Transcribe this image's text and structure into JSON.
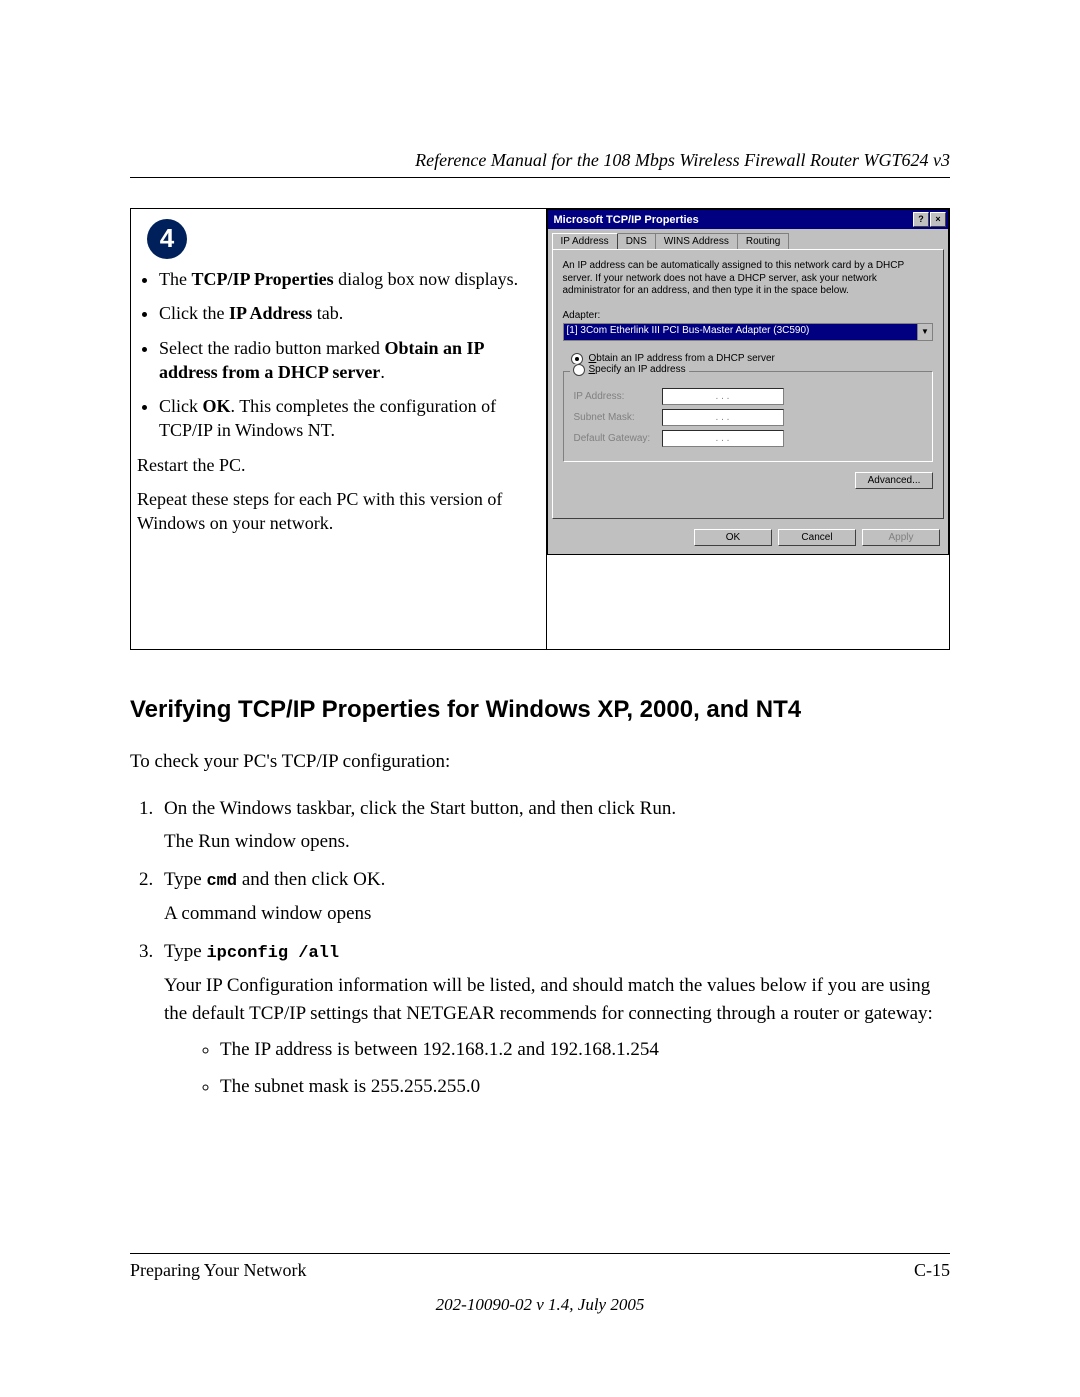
{
  "header": {
    "title": "Reference Manual for the 108 Mbps Wireless Firewall Router WGT624 v3"
  },
  "step": {
    "number": "4",
    "bullets": {
      "b1_pre": "The ",
      "b1_bold": "TCP/IP Properties",
      "b1_post": " dialog box now displays.",
      "b2_pre": "Click the ",
      "b2_bold": "IP Address",
      "b2_post": " tab.",
      "b3_pre": "Select the radio button marked ",
      "b3_bold": "Obtain an IP address from a DHCP server",
      "b3_post": ".",
      "b4_pre": "Click ",
      "b4_bold": "OK",
      "b4_post": ".  This completes the configuration of TCP/IP in Windows NT."
    },
    "restart": "Restart the PC.",
    "repeat": "Repeat these steps for each PC with this version of Windows on your network."
  },
  "dialog": {
    "title": "Microsoft TCP/IP Properties",
    "help_btn": "?",
    "close_btn": "×",
    "tabs": {
      "t1": "IP Address",
      "t2": "DNS",
      "t3": "WINS Address",
      "t4": "Routing"
    },
    "info": "An IP address can be automatically assigned to this network card by a DHCP server. If your network does not have a DHCP server, ask your network administrator for an address, and then type it in the space below.",
    "adapter_label": "Adapter:",
    "adapter_value": "[1] 3Com Etherlink III PCI Bus-Master Adapter (3C590)",
    "dropdown_arrow": "▼",
    "radio_obtain": "Obtain an IP address from a DHCP server",
    "radio_specify": "Specify an IP address",
    "fields": {
      "ip": "IP Address:",
      "mask": "Subnet Mask:",
      "gw": "Default Gateway:"
    },
    "ip_dots": ". . .",
    "advanced": "Advanced...",
    "ok": "OK",
    "cancel": "Cancel",
    "apply": "Apply"
  },
  "section": {
    "heading": "Verifying TCP/IP Properties for Windows XP, 2000, and NT4",
    "intro": "To check your PC's TCP/IP configuration:",
    "s1_a": "On the Windows taskbar, click the Start button, and then click Run.",
    "s1_b": "The Run window opens.",
    "s2_a_pre": "Type ",
    "s2_a_code": "cmd",
    "s2_a_post": " and then click OK.",
    "s2_b": "A command window opens",
    "s3_a_pre": "Type ",
    "s3_a_code": "ipconfig /all",
    "s3_b": "Your IP Configuration information will be listed, and should match the values below if you are using the default TCP/IP settings that NETGEAR recommends for connecting through a router or gateway:",
    "s3_bul1": "The IP address is between 192.168.1.2 and 192.168.1.254",
    "s3_bul2": "The subnet mask is 255.255.255.0"
  },
  "footer": {
    "left": "Preparing Your Network",
    "right": "C-15",
    "doc": "202-10090-02 v 1.4, July 2005"
  }
}
